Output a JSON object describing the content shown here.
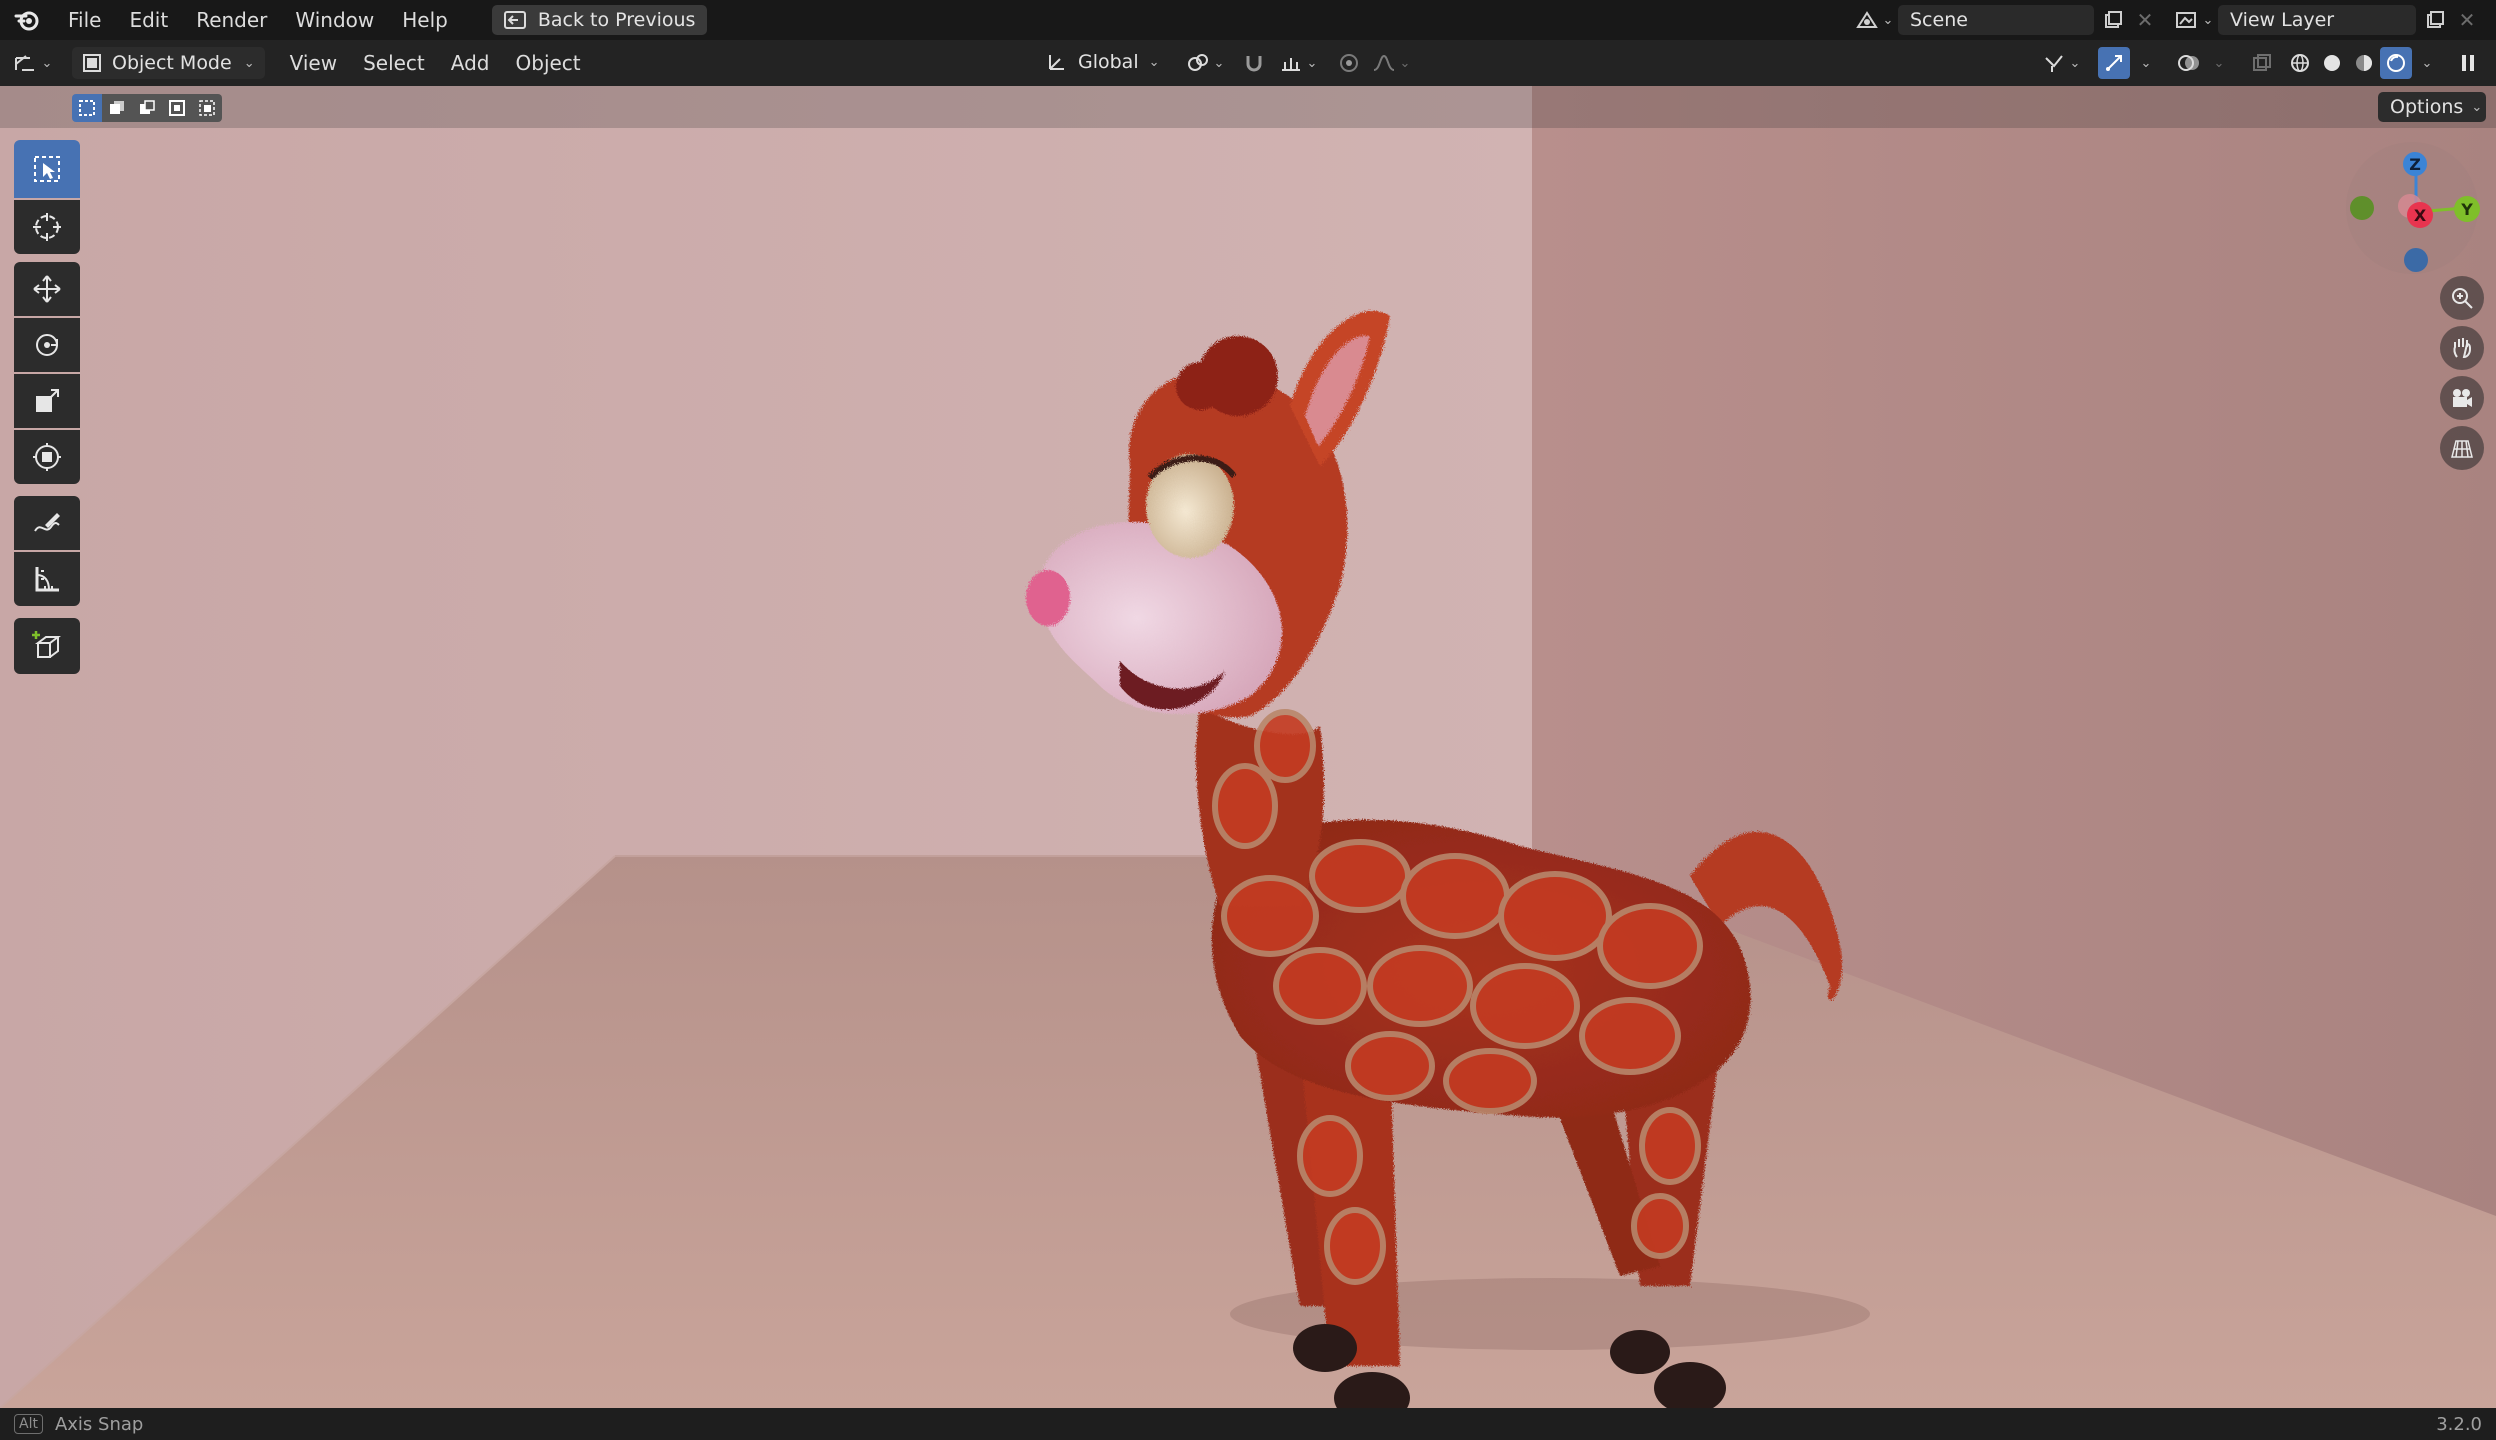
{
  "menu": {
    "items": [
      "File",
      "Edit",
      "Render",
      "Window",
      "Help"
    ],
    "back_button": "Back to Previous",
    "scene_name": "Scene",
    "view_layer_name": "View Layer"
  },
  "viewport_header": {
    "mode": "Object Mode",
    "menus": [
      "View",
      "Select",
      "Add",
      "Object"
    ],
    "orientation": "Global"
  },
  "tool_settings": {
    "options_label": "Options"
  },
  "gizmo": {
    "axes": [
      "Z",
      "X",
      "Y"
    ],
    "colors": {
      "x": "#e8344f",
      "y": "#7fbf2a",
      "z": "#3b84d6"
    }
  },
  "status": {
    "key_hint": "Alt",
    "hint_text": "Axis Snap",
    "version": "3.2.0"
  },
  "theme": {
    "accent": "#4772b3",
    "wall_left": "#c7a6a5",
    "wall_right": "#b48c89",
    "floor": "#bf9a90",
    "giraffe_fur": "#b03a24"
  }
}
